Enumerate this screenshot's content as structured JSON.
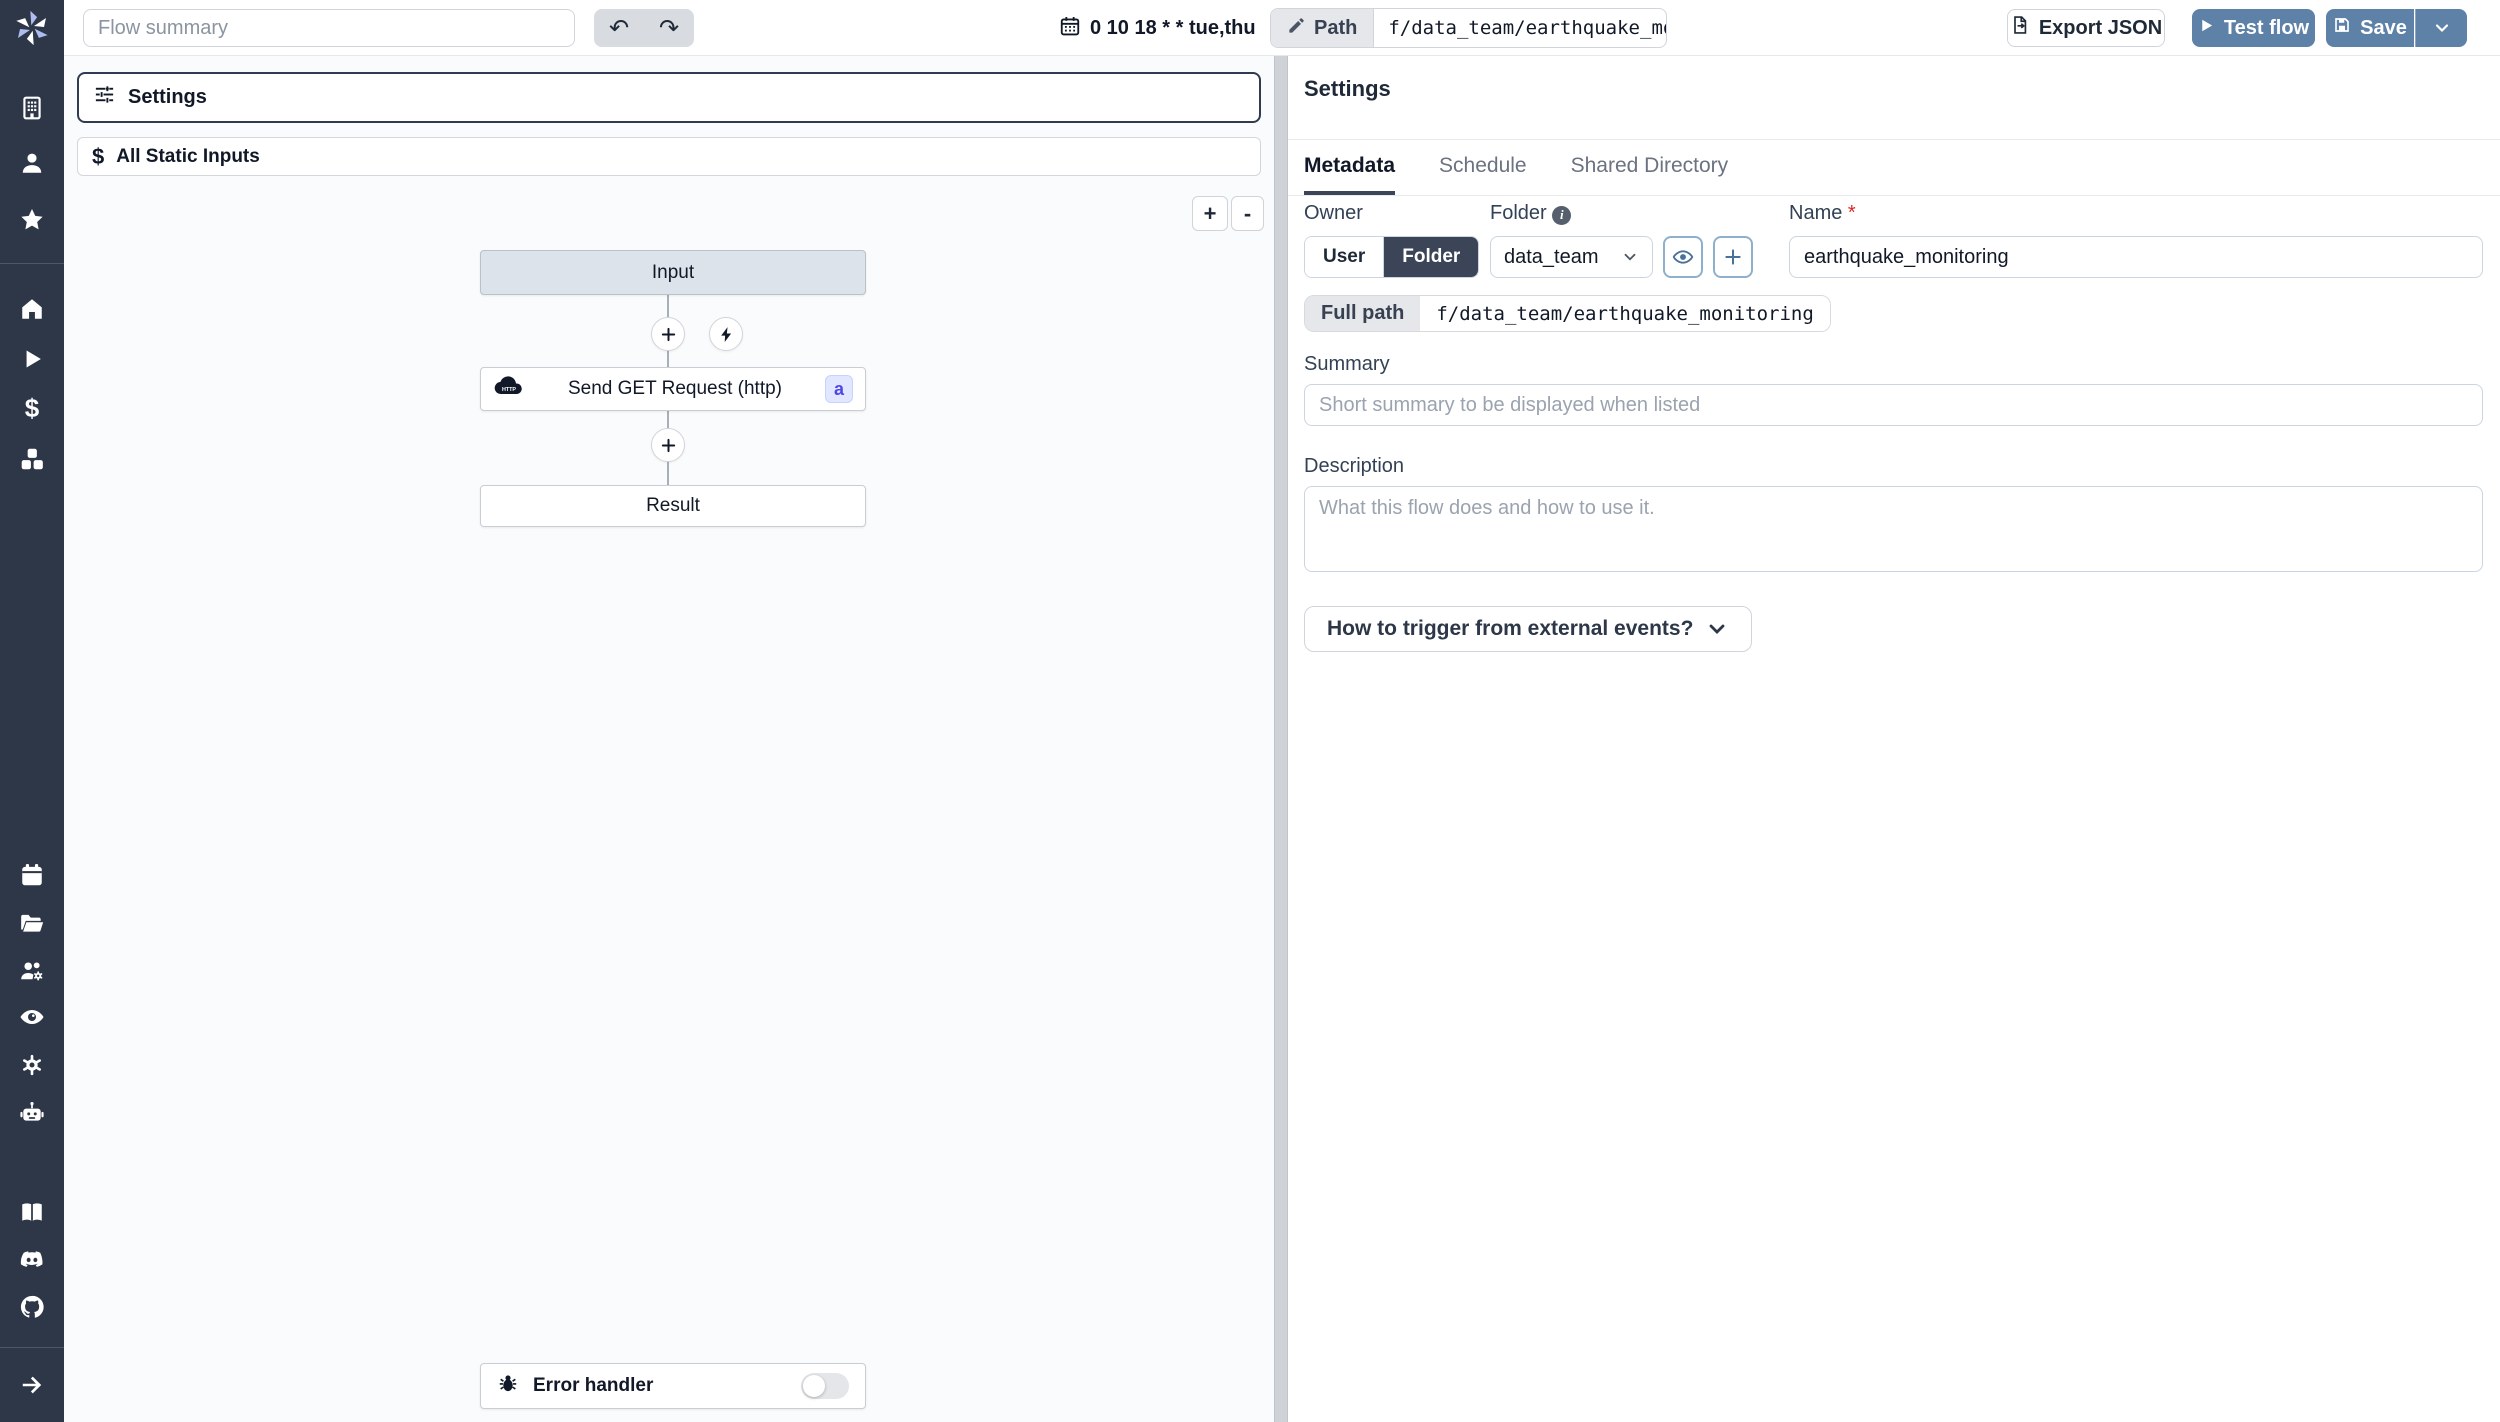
{
  "colors": {
    "sidebar_bg": "#2e3748",
    "accent_blue": "#5e81a8",
    "selected_border": "#303b50",
    "input_node_bg": "#dce3ea",
    "badge_bg": "#e0e7ff",
    "badge_text": "#4f46e5",
    "required_red": "#dc2626"
  },
  "topbar": {
    "flow_summary_placeholder": "Flow summary",
    "undo_icon": "undo-arrow",
    "redo_icon": "redo-arrow",
    "cron_schedule": "0 10 18 * * tue,thu",
    "path_label": "Path",
    "path_value": "f/data_team/earthquake_monit",
    "export_json": "Export JSON",
    "test_flow": "Test flow",
    "save": "Save"
  },
  "left_panel": {
    "settings_label": "Settings",
    "static_inputs_label": "All Static Inputs",
    "zoom_in": "+",
    "zoom_out": "-"
  },
  "flow": {
    "input_label": "Input",
    "step_label": "Send GET Request (http)",
    "step_icon": "http-cloud",
    "step_badge": "a",
    "result_label": "Result",
    "error_handler_label": "Error handler",
    "error_handler_enabled": false
  },
  "settings_panel": {
    "title": "Settings",
    "tabs": [
      {
        "label": "Metadata",
        "active": true
      },
      {
        "label": "Schedule",
        "active": false
      },
      {
        "label": "Shared Directory",
        "active": false
      }
    ],
    "owner_label": "Owner",
    "owner_options": [
      "User",
      "Folder"
    ],
    "owner_user": "User",
    "owner_folder": "Folder",
    "owner_selected": "Folder",
    "folder_label": "Folder",
    "folder_value": "data_team",
    "name_label": "Name",
    "name_required": "*",
    "name_value": "earthquake_monitoring",
    "full_path_label": "Full path",
    "full_path_value": "f/data_team/earthquake_monitoring",
    "summary_label": "Summary",
    "summary_placeholder": "Short summary to be displayed when listed",
    "description_label": "Description",
    "description_placeholder": "What this flow does and how to use it.",
    "trigger_button": "How to trigger from external events?"
  }
}
